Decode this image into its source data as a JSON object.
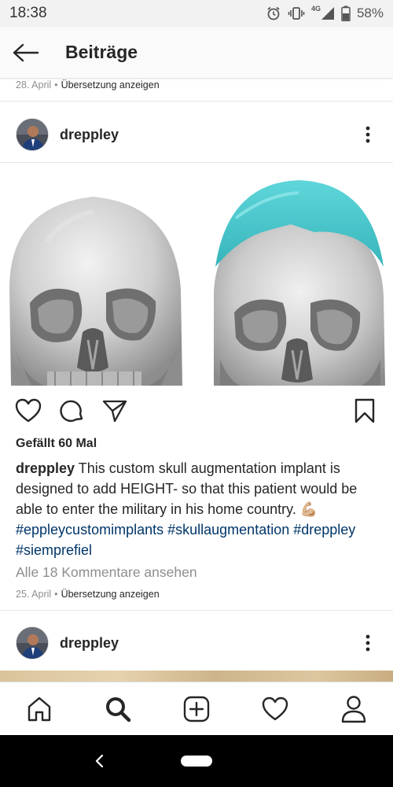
{
  "status_bar": {
    "time": "18:38",
    "network": "4G",
    "battery": "58%"
  },
  "header": {
    "title": "Beiträge",
    "back_icon": "arrow-left-icon"
  },
  "previous_post": {
    "date": "28. April",
    "separator": "•",
    "translate_label": "Übersetzung anzeigen"
  },
  "post": {
    "username": "dreppley",
    "image_description_icons": [
      "skull-image-left",
      "skull-image-right-with-implant"
    ],
    "implant_color": "#3fc4c9",
    "likes": "Gefällt 60 Mal",
    "caption_user": "dreppley",
    "caption_text": "This custom skull augmentation implant is designed to add HEIGHT- so that this patient would be able to enter the military in his home country.",
    "caption_emoji": "💪🏼",
    "hashtags": [
      "#eppleycustomimplants",
      "#skullaugmentation",
      "#dreppley",
      "#siemprefiel"
    ],
    "view_comments": "Alle 18 Kommentare ansehen",
    "date": "25. April",
    "separator": "•",
    "translate_label": "Übersetzung anzeigen"
  },
  "next_post": {
    "username": "dreppley"
  },
  "bottom_nav": [
    "home-icon",
    "search-icon",
    "new-post-icon",
    "activity-heart-icon",
    "profile-icon"
  ]
}
